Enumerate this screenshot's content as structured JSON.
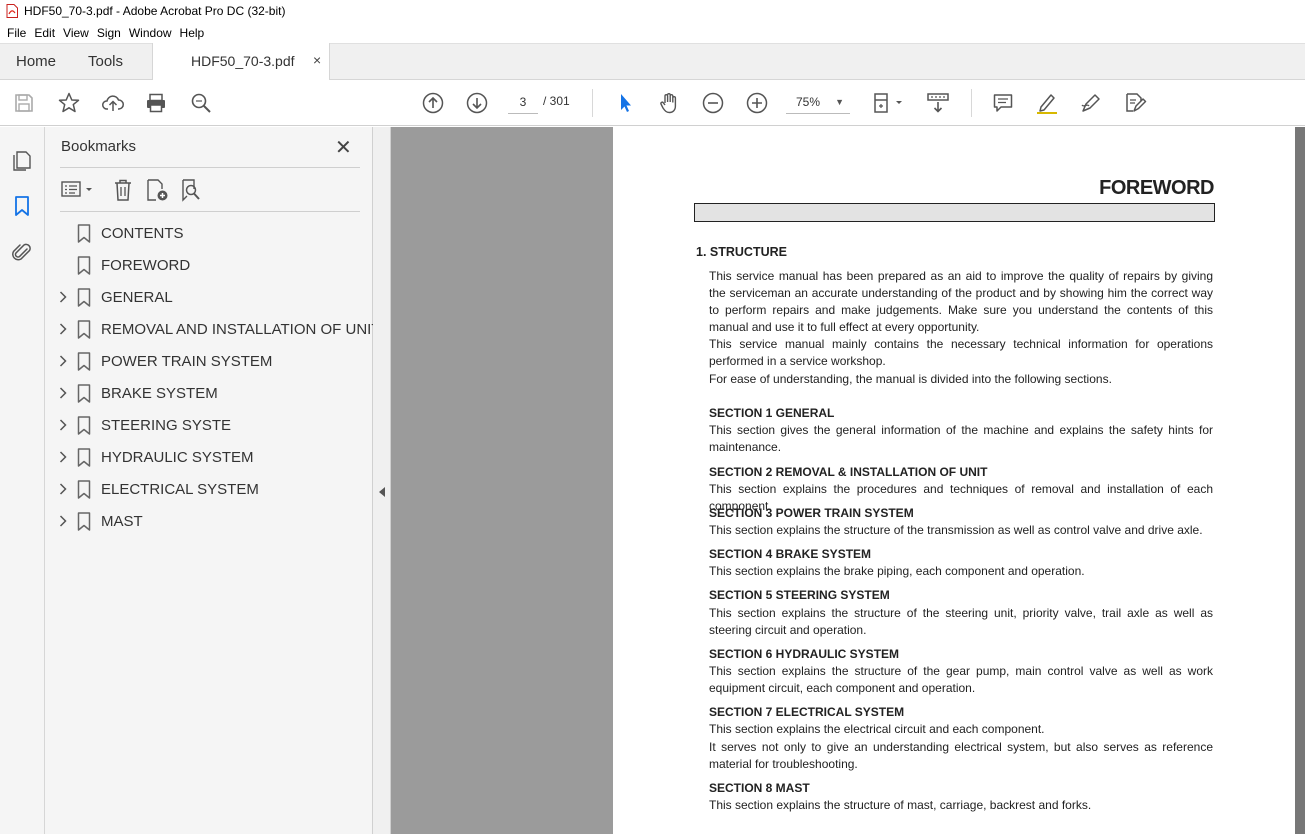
{
  "window": {
    "title": "HDF50_70-3.pdf - Adobe Acrobat Pro DC (32-bit)"
  },
  "menu": [
    "File",
    "Edit",
    "View",
    "Sign",
    "Window",
    "Help"
  ],
  "tabs": {
    "home": "Home",
    "tools": "Tools",
    "document": "HDF50_70-3.pdf",
    "close": "×"
  },
  "toolbar": {
    "page_current": "3",
    "page_total": "/  301",
    "zoom": "75%"
  },
  "bookmarks": {
    "title": "Bookmarks",
    "close": "✕",
    "items": [
      {
        "label": "CONTENTS",
        "expandable": false
      },
      {
        "label": "FOREWORD",
        "expandable": false
      },
      {
        "label": "GENERAL",
        "expandable": true
      },
      {
        "label": "REMOVAL AND INSTALLATION OF UNIT",
        "expandable": true
      },
      {
        "label": "POWER TRAIN SYSTEM",
        "expandable": true
      },
      {
        "label": "BRAKE SYSTEM",
        "expandable": true
      },
      {
        "label": "STEERING SYSTE",
        "expandable": true
      },
      {
        "label": "HYDRAULIC SYSTEM",
        "expandable": true
      },
      {
        "label": "ELECTRICAL SYSTEM",
        "expandable": true
      },
      {
        "label": "MAST",
        "expandable": true
      }
    ]
  },
  "document": {
    "title": "FOREWORD",
    "heading": "1.  STRUCTURE",
    "intro1": "This service manual has been prepared as an aid to improve the quality of repairs by giving the serviceman an accurate understanding of the product and by showing him the correct way to perform repairs and make judgements.   Make sure you understand the contents of this manual and use it to full effect at every opportunity.",
    "intro2": "This service manual mainly contains the necessary technical information for operations performed in a service workshop.",
    "intro3": "For ease of understanding, the manual is divided into the following sections.",
    "sections": [
      {
        "title": "SECTION 1  GENERAL",
        "text": "This section gives the general information of the machine and explains the safety hints for maintenance."
      },
      {
        "title": "SECTION 2  REMOVAL & INSTALLATION OF UNIT",
        "text": "This section explains the procedures and techniques of removal and installation of each component."
      },
      {
        "title": "SECTION 3  POWER TRAIN SYSTEM",
        "text": "This section explains the structure of the transmission as well as control valve and drive axle."
      },
      {
        "title": "SECTION 4  BRAKE SYSTEM",
        "text": "This section explains the brake piping, each component and operation."
      },
      {
        "title": "SECTION 5  STEERING SYSTEM",
        "text": "This section explains the structure of the steering unit, priority valve, trail axle as well as steering circuit and operation."
      },
      {
        "title": "SECTION 6  HYDRAULIC SYSTEM",
        "text": "This section explains the structure of the gear pump, main control valve as well as work equipment circuit, each component and operation."
      },
      {
        "title": "SECTION 7  ELECTRICAL SYSTEM",
        "text": "This section explains the electrical circuit and each component.",
        "text2": "It serves not only to give an understanding electrical system, but also serves as reference material for troubleshooting."
      },
      {
        "title": "SECTION 8  MAST",
        "text": "This section explains the structure of mast, carriage, backrest and forks."
      }
    ]
  },
  "colors": {
    "accent_blue": "#1473e6",
    "pdf_red": "#e0261a",
    "doc_bg": "#9b9b9b"
  }
}
